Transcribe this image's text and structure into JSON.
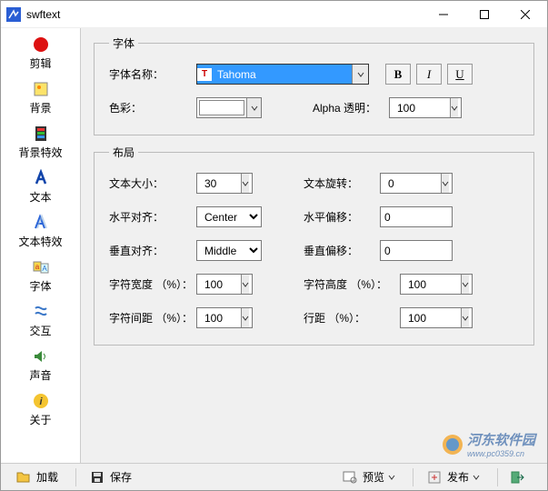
{
  "window": {
    "title": "swftext"
  },
  "sidebar": {
    "items": [
      {
        "label": "剪辑"
      },
      {
        "label": "背景"
      },
      {
        "label": "背景特效"
      },
      {
        "label": "文本"
      },
      {
        "label": "文本特效"
      },
      {
        "label": "字体"
      },
      {
        "label": "交互"
      },
      {
        "label": "声音"
      },
      {
        "label": "关于"
      }
    ]
  },
  "font_group": {
    "legend": "字体",
    "name_label": "字体名称：",
    "name_value": "Tahoma",
    "bold": "B",
    "italic": "I",
    "underline": "U",
    "color_label": "色彩：",
    "alpha_label": "Alpha 透明：",
    "alpha_value": "100"
  },
  "layout_group": {
    "legend": "布局",
    "textsize_label": "文本大小：",
    "textsize_value": "30",
    "rotate_label": "文本旋转：",
    "rotate_value": "0",
    "halign_label": "水平对齐：",
    "halign_value": "Center",
    "hoffset_label": "水平偏移：",
    "hoffset_value": "0",
    "valign_label": "垂直对齐：",
    "valign_value": "Middle",
    "voffset_label": "垂直偏移：",
    "voffset_value": "0",
    "cwidth_label": "字符宽度 （%）：",
    "cwidth_value": "100",
    "cheight_label": "字符高度 （%）：",
    "cheight_value": "100",
    "cspace_label": "字符间距 （%）：",
    "cspace_value": "100",
    "lspace_label": "行距 （%）：",
    "lspace_value": "100"
  },
  "bottom": {
    "load": "加载",
    "save": "保存",
    "preview": "预览",
    "publish": "发布"
  },
  "watermark": {
    "text": "河东软件园",
    "url": "www.pc0359.cn"
  }
}
